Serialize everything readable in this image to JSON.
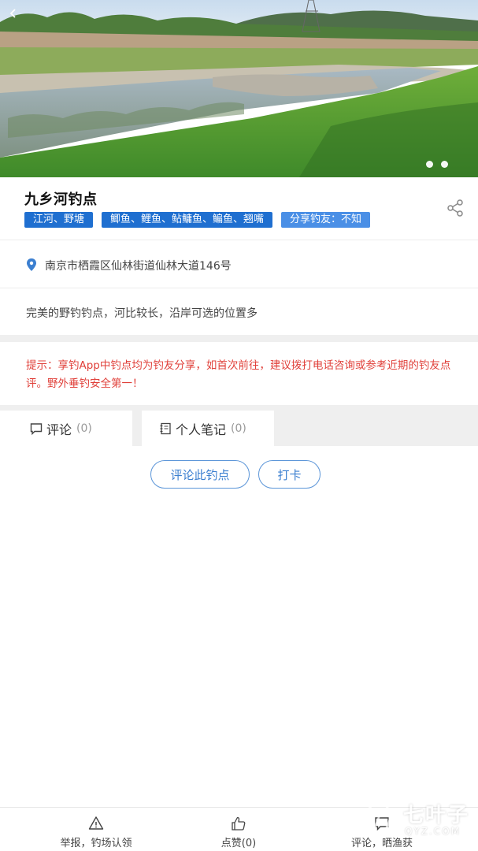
{
  "spot": {
    "title": "九乡河钓点",
    "tags": {
      "water_type": "江河、野塘",
      "fish": "鲫鱼、鲤鱼、鲇鳙鱼、鳊鱼、翘嘴",
      "shared_by": "分享钓友：不知"
    },
    "address": "南京市栖霞区仙林街道仙林大道146号",
    "description": "完美的野钓钓点，河比较长，沿岸可选的位置多"
  },
  "warning": "提示：享钓App中钓点均为钓友分享，如首次前往，建议拨打电话咨询或参考近期的钓友点评。野外垂钓安全第一！",
  "tabs": [
    {
      "label": "评论",
      "count": "(0)",
      "icon": "comment-icon"
    },
    {
      "label": "个人笔记",
      "count": "(0)",
      "icon": "notebook-icon"
    }
  ],
  "actions": {
    "comment_label": "评论此钓点",
    "checkin_label": "打卡"
  },
  "bottom_bar": {
    "report_label": "举报，钓场认领",
    "like_label": "点赞(0)",
    "review_label": "评论，晒渔获"
  },
  "watermark": {
    "text": "七叶子",
    "sub": "QYZ.COM"
  },
  "colors": {
    "tag_dark": "#1f6fd0",
    "tag_light": "#4a8fe6",
    "warning": "#e0403a",
    "accent": "#3b7fd0"
  }
}
